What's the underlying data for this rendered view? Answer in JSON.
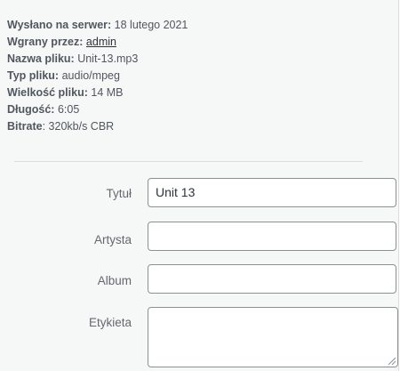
{
  "details": {
    "uploaded_label": "Wysłano na serwer:",
    "uploaded_value": "18 lutego 2021",
    "uploader_label": "Wgrany przez:",
    "uploader_value": "admin",
    "filename_label": "Nazwa pliku:",
    "filename_value": "Unit-13.mp3",
    "filetype_label": "Typ pliku:",
    "filetype_value": "audio/mpeg",
    "filesize_label": "Wielkość pliku:",
    "filesize_value": "14 MB",
    "length_label": "Długość:",
    "length_value": "6:05",
    "bitrate_label": "Bitrate",
    "bitrate_value": "320kb/s CBR"
  },
  "form": {
    "title_label": "Tytuł",
    "title_value": "Unit 13",
    "artist_label": "Artysta",
    "artist_value": "",
    "album_label": "Album",
    "album_value": "",
    "caption_label": "Etykieta",
    "caption_value": ""
  }
}
